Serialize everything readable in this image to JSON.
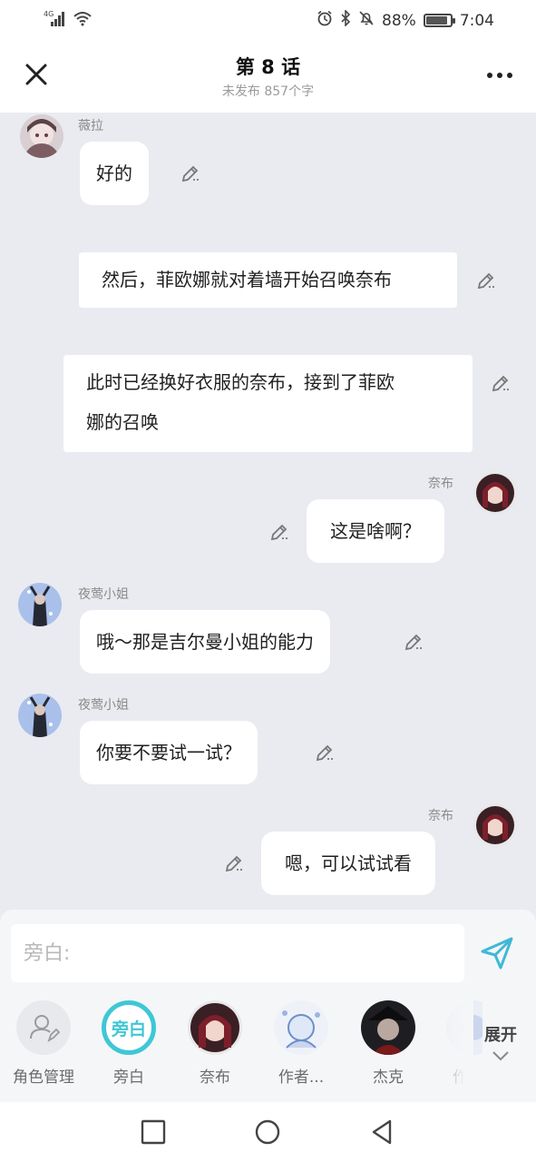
{
  "status_bar": {
    "network": "4G",
    "battery_percent": "88%",
    "battery_level": 0.88,
    "time": "7:04",
    "icons": [
      "signal-icon",
      "wifi-icon",
      "alarm-icon",
      "bluetooth-icon",
      "mute-icon",
      "battery-icon"
    ]
  },
  "header": {
    "title": "第 8 话",
    "subtitle": "未发布 857个字",
    "close_icon": "close-icon",
    "more_icon": "more-icon"
  },
  "messages": [
    {
      "type": "left",
      "speaker": "薇拉",
      "text": "好的",
      "avatar_color": "#8a6a68"
    },
    {
      "type": "narration",
      "text": "然后，菲欧娜就对着墙开始召唤奈布"
    },
    {
      "type": "narration",
      "line1": "此时已经换好衣服的奈布，接到了菲欧",
      "line2": "娜的召唤"
    },
    {
      "type": "right",
      "speaker": "奈布",
      "text": "这是啥啊？",
      "avatar_color": "#6b2630"
    },
    {
      "type": "left",
      "speaker": "夜莺小姐",
      "text": "哦～那是吉尔曼小姐的能力",
      "avatar_color": "#8aa6d8"
    },
    {
      "type": "left",
      "speaker": "夜莺小姐",
      "text": "你要不要试一试？",
      "avatar_color": "#8aa6d8"
    },
    {
      "type": "right",
      "speaker": "奈布",
      "text": "嗯，可以试试看",
      "avatar_color": "#6b2630"
    }
  ],
  "input": {
    "placeholder": "旁白:",
    "send_icon": "send-icon"
  },
  "roles": [
    {
      "label": "角色管理",
      "icon": "role-manage-icon"
    },
    {
      "label": "旁白",
      "circle_text": "旁白",
      "selected": true
    },
    {
      "label": "奈布"
    },
    {
      "label": "作者..."
    },
    {
      "label": "杰克"
    },
    {
      "label": "作"
    }
  ],
  "expand_label": "展开",
  "colors": {
    "accent": "#3fc7d6",
    "background": "#e9ebf0",
    "bubble": "#ffffff",
    "send": "#3fb8d6"
  }
}
